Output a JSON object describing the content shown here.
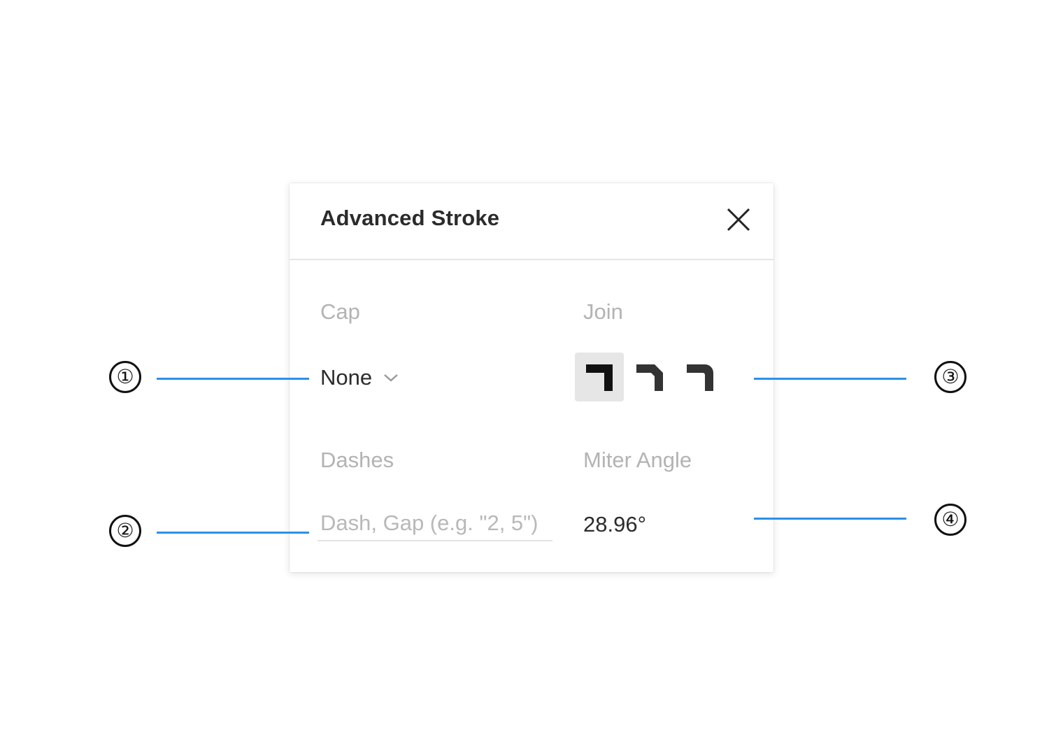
{
  "panel": {
    "title": "Advanced Stroke",
    "close_icon": "close-icon"
  },
  "cap": {
    "label": "Cap",
    "value": "None",
    "dropdown_icon": "chevron-down-icon"
  },
  "join": {
    "label": "Join",
    "options": [
      "miter-join-icon",
      "bevel-join-icon",
      "round-join-icon"
    ],
    "selected_index": 0
  },
  "dashes": {
    "label": "Dashes",
    "placeholder": "Dash, Gap (e.g. \"2, 5\")",
    "value": ""
  },
  "miter": {
    "label": "Miter Angle",
    "value": "28.96°"
  },
  "callouts": [
    "①",
    "②",
    "③",
    "④"
  ],
  "colors": {
    "callout_line": "#2e8fe6",
    "selected_bg": "#e6e6e6",
    "label_gray": "#b3b3b3",
    "text_dark": "#2b2b2b"
  }
}
